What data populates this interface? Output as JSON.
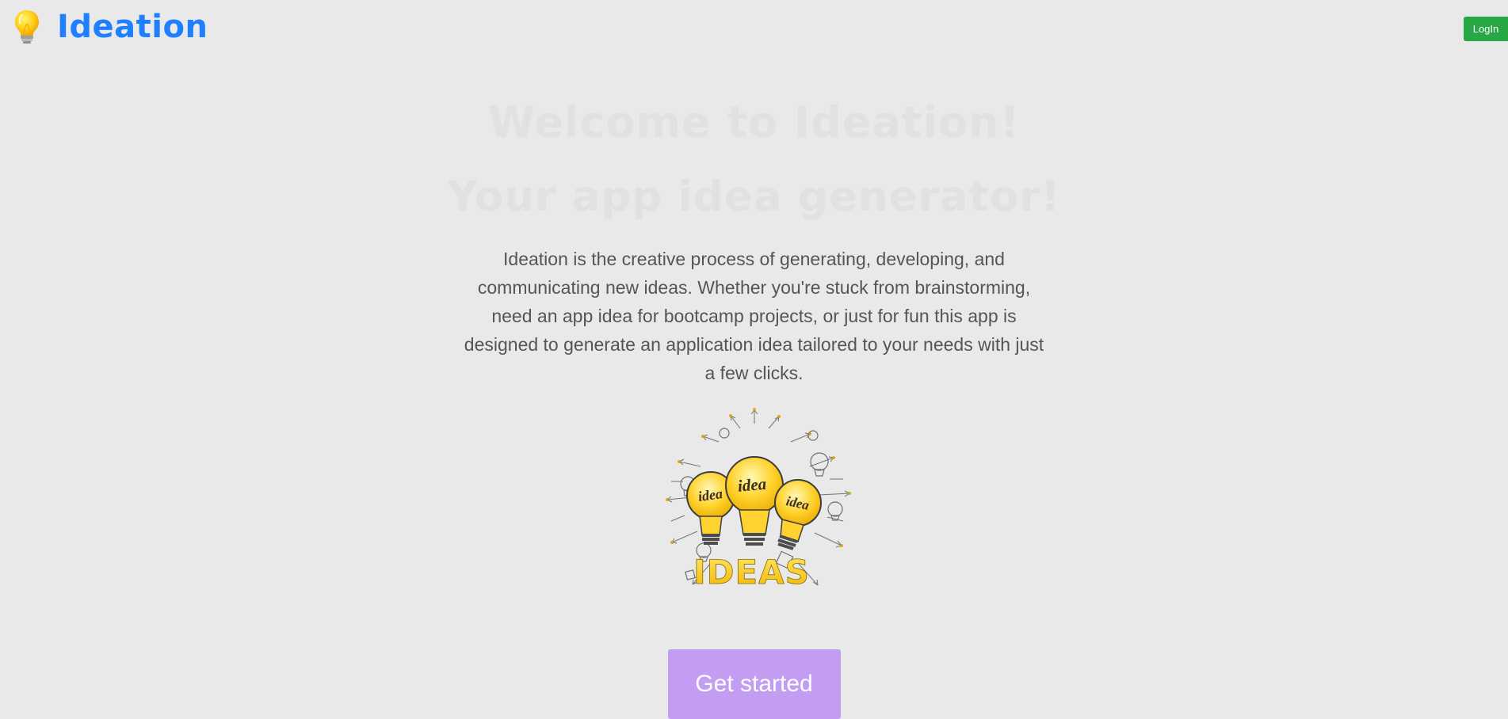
{
  "header": {
    "brand_title": "Ideation",
    "brand_icon": "lightbulb-icon",
    "login_label": "LogIn",
    "brand_color": "#1e7fff",
    "login_color": "#28a745"
  },
  "hero": {
    "heading_line_1": "Welcome to Ideation!",
    "heading_line_2": "Your app idea generator!",
    "description": "Ideation is the creative process of generating, developing, and communicating new ideas. Whether you're stuck from brainstorming, need an app idea for bootcamp projects, or just for fun this app is designed to generate an application idea tailored to your needs with just a few clicks.",
    "image_label": "IDEAS",
    "bulb_labels": [
      "idea",
      "idea",
      "idea"
    ],
    "image_icon": "idea-lightbulbs-illustration-icon",
    "cta_label": "Get started",
    "cta_color": "#c39df1"
  }
}
